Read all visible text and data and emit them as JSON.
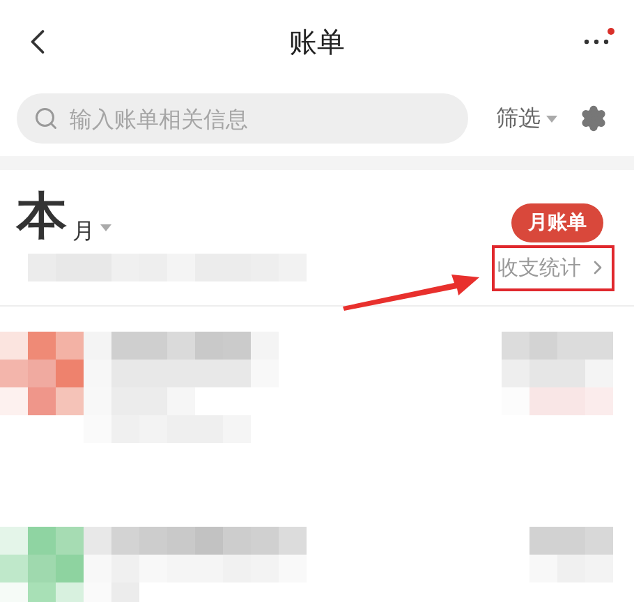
{
  "header": {
    "title": "账单",
    "has_notification": true
  },
  "search": {
    "placeholder": "输入账单相关信息"
  },
  "filter": {
    "label": "筛选"
  },
  "period": {
    "main": "本",
    "unit": "月"
  },
  "monthly_bill_button": {
    "label": "月账单"
  },
  "stats_link": {
    "label": "收支统计",
    "highlighted": true
  },
  "transactions": [
    {
      "kind": "expense"
    },
    {
      "kind": "income"
    }
  ]
}
